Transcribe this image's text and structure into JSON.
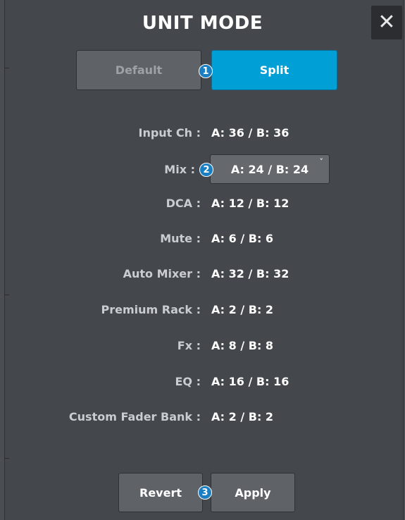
{
  "dialog": {
    "title": "UNIT MODE",
    "close_glyph": "✕",
    "close_icon": "close-icon"
  },
  "mode": {
    "options": [
      "Default",
      "Split"
    ],
    "selected": "Split",
    "default_label": "Default",
    "split_label": "Split"
  },
  "markers": [
    "1",
    "2",
    "3"
  ],
  "settings": {
    "input_ch": {
      "label": "Input Ch :",
      "value": "A: 36 / B: 36"
    },
    "mix": {
      "label": "Mix :",
      "value": "A: 24 / B: 24",
      "chevron": "˅"
    },
    "dca": {
      "label": "DCA :",
      "value": "A: 12 / B: 12"
    },
    "mute": {
      "label": "Mute :",
      "value": "A: 6 / B: 6"
    },
    "auto_mixer": {
      "label": "Auto Mixer :",
      "value": "A: 32 / B: 32"
    },
    "premium_rack": {
      "label": "Premium Rack :",
      "value": "A: 2 / B: 2"
    },
    "fx": {
      "label": "Fx :",
      "value": "A: 8 / B: 8"
    },
    "eq": {
      "label": "EQ :",
      "value": "A: 16 / B: 16"
    },
    "custom_fader_bank": {
      "label": "Custom Fader Bank :",
      "value": "A: 2 / B: 2"
    }
  },
  "actions": {
    "revert_label": "Revert",
    "apply_label": "Apply"
  },
  "colors": {
    "accent": "#009fd6",
    "marker": "#1a7ec1",
    "panel": "#44474b"
  }
}
